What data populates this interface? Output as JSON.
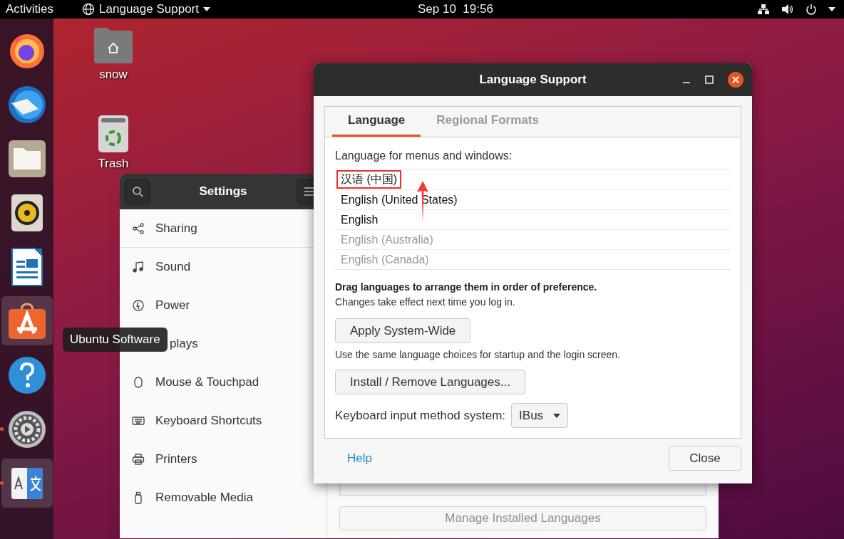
{
  "top_bar": {
    "activities": "Activities",
    "app_menu": "Language Support",
    "clock": "Sep 10  19:56"
  },
  "dock": {
    "items": [
      {
        "kind": "firefox",
        "running": false,
        "highlighted": false
      },
      {
        "kind": "mail",
        "running": false,
        "highlighted": false
      },
      {
        "kind": "files",
        "running": false,
        "highlighted": false
      },
      {
        "kind": "music",
        "running": false,
        "highlighted": false
      },
      {
        "kind": "writer",
        "running": false,
        "highlighted": false
      },
      {
        "kind": "software",
        "running": false,
        "highlighted": true
      },
      {
        "kind": "help",
        "running": false,
        "highlighted": false
      },
      {
        "kind": "updater",
        "running": true,
        "highlighted": false
      },
      {
        "kind": "language",
        "running": true,
        "highlighted": true
      }
    ],
    "tooltip": "Ubuntu Software"
  },
  "desktop_icons": [
    {
      "kind": "home",
      "label": "snow"
    },
    {
      "kind": "trash",
      "label": "Trash"
    }
  ],
  "settings": {
    "title": "Settings",
    "items": [
      {
        "kind": "sharing",
        "label": "Sharing"
      },
      {
        "kind": "sound",
        "label": "Sound"
      },
      {
        "kind": "power",
        "label": "Power"
      },
      {
        "kind": "displays",
        "label": "plays"
      },
      {
        "kind": "mouse",
        "label": "Mouse & Touchpad"
      },
      {
        "kind": "keyboard",
        "label": "Keyboard Shortcuts"
      },
      {
        "kind": "printers",
        "label": "Printers"
      },
      {
        "kind": "media",
        "label": "Removable Media"
      }
    ],
    "panel_button": {
      "label": "Manage Installed Languages",
      "disabled": true
    }
  },
  "dialog": {
    "title": "Language Support",
    "tabs": [
      {
        "label": "Language",
        "selected": true
      },
      {
        "label": "Regional Formats",
        "selected": false
      }
    ],
    "list_label": "Language for menus and windows:",
    "languages": [
      {
        "label": "汉语 (中国)",
        "disabled": false,
        "highlighted": true
      },
      {
        "label": "English (United States)",
        "disabled": false,
        "highlighted": false
      },
      {
        "label": "English",
        "disabled": false,
        "highlighted": false
      },
      {
        "label": "English (Australia)",
        "disabled": true,
        "highlighted": false
      },
      {
        "label": "English (Canada)",
        "disabled": true,
        "highlighted": false
      }
    ],
    "hint_bold": "Drag languages to arrange them in order of preference.",
    "hint": "Changes take effect next time you log in.",
    "apply_button": "Apply System-Wide",
    "apply_note": "Use the same language choices for startup and the login screen.",
    "install_button": "Install / Remove Languages...",
    "input_method_label": "Keyboard input method system:",
    "input_method": "IBus",
    "help": "Help",
    "close_button": "Close"
  }
}
